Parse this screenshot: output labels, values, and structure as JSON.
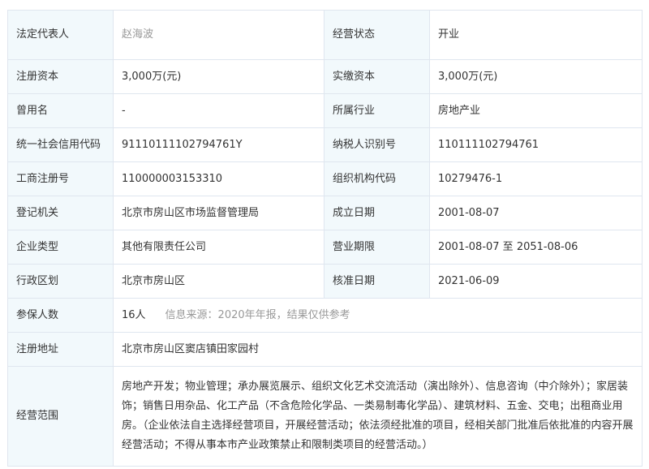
{
  "rows": [
    {
      "k1": "法定代表人",
      "v1": "赵海波",
      "k2": "经营状态",
      "v2": "开业"
    },
    {
      "k1": "注册资本",
      "v1": "3,000万(元)",
      "k2": "实缴资本",
      "v2": "3,000万(元)"
    },
    {
      "k1": "曾用名",
      "v1": "-",
      "k2": "所属行业",
      "v2": "房地产业"
    },
    {
      "k1": "统一社会信用代码",
      "v1": "91110111102794761Y",
      "k2": "纳税人识别号",
      "v2": "110111102794761"
    },
    {
      "k1": "工商注册号",
      "v1": "110000003153310",
      "k2": "组织机构代码",
      "v2": "10279476-1"
    },
    {
      "k1": "登记机关",
      "v1": "北京市房山区市场监督管理局",
      "k2": "成立日期",
      "v2": "2001-08-07"
    },
    {
      "k1": "企业类型",
      "v1": "其他有限责任公司",
      "k2": "营业期限",
      "v2": "2001-08-07 至 2051-08-06"
    },
    {
      "k1": "行政区划",
      "v1": "北京市房山区",
      "k2": "核准日期",
      "v2": "2021-06-09"
    }
  ],
  "insured": {
    "label": "参保人数",
    "value": "16人",
    "note": "信息来源：2020年年报，结果仅供参考"
  },
  "address": {
    "label": "注册地址",
    "value": "北京市房山区窦店镇田家园村"
  },
  "scope": {
    "label": "经营范围",
    "value": "房地产开发；物业管理；承办展览展示、组织文化艺术交流活动（演出除外）、信息咨询（中介除外）；家居装饰；销售日用杂品、化工产品（不含危险化学品、一类易制毒化学品）、建筑材料、五金、交电；出租商业用房。（企业依法自主选择经营项目，开展经营活动；依法须经批准的项目，经相关部门批准后依批准的内容开展经营活动；不得从事本市产业政策禁止和限制类项目的经营活动。）"
  }
}
